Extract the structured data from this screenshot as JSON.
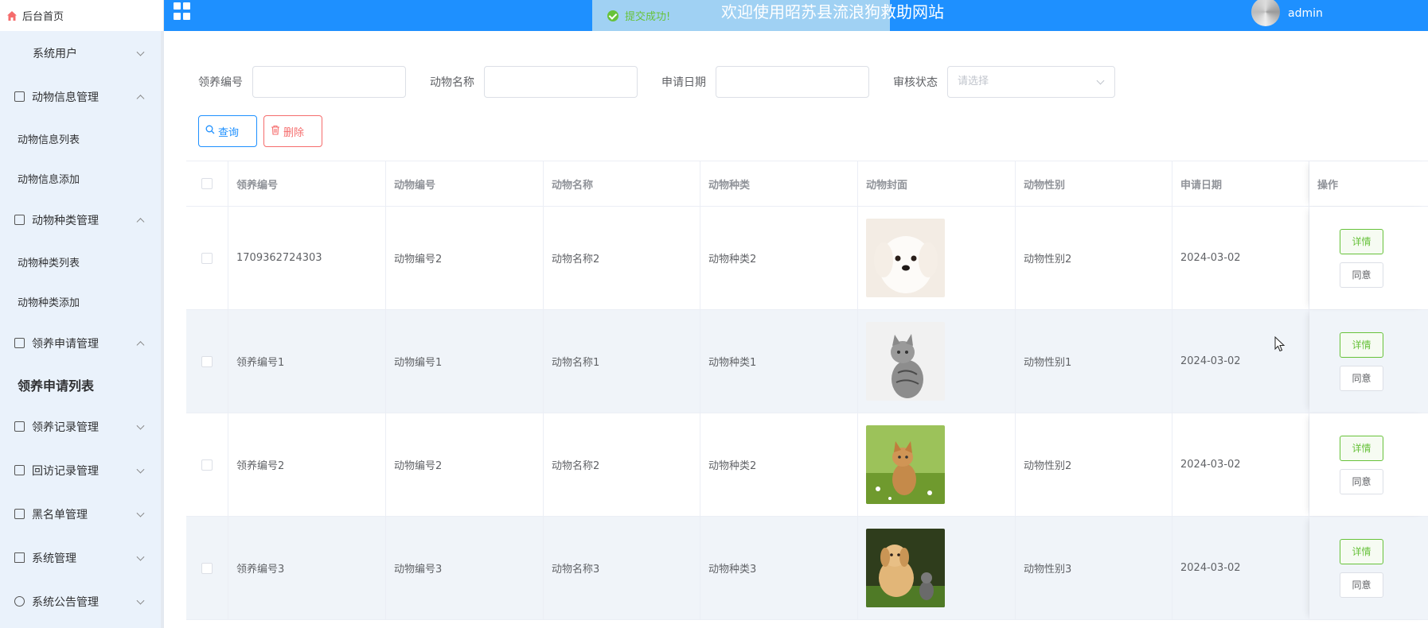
{
  "brand": {
    "label": "后台首页",
    "icon": "home-icon"
  },
  "header": {
    "title": "欢迎使用昭苏县流浪狗救助网站",
    "user": "admin",
    "toast": "提交成功!",
    "accent": "#1e90ff"
  },
  "sidebar": {
    "items": [
      {
        "label": "系统用户",
        "icon": "user-icon",
        "expanded": false
      },
      {
        "label": "动物信息管理",
        "icon": "module-icon",
        "expanded": true,
        "children": [
          "动物信息列表",
          "动物信息添加"
        ]
      },
      {
        "label": "动物种类管理",
        "icon": "module-icon",
        "expanded": true,
        "children": [
          "动物种类列表",
          "动物种类添加"
        ]
      },
      {
        "label": "领养申请管理",
        "icon": "module-icon",
        "expanded": true,
        "children": [
          "领养申请列表"
        ]
      },
      {
        "label": "领养记录管理",
        "icon": "module-icon",
        "expanded": false
      },
      {
        "label": "回访记录管理",
        "icon": "module-icon",
        "expanded": false
      },
      {
        "label": "黑名单管理",
        "icon": "module-icon",
        "expanded": false
      },
      {
        "label": "系统管理",
        "icon": "picture-icon",
        "expanded": false
      },
      {
        "label": "系统公告管理",
        "icon": "info-icon",
        "expanded": false
      }
    ],
    "active": "领养申请列表"
  },
  "filters": {
    "adopt_no": {
      "label": "领养编号",
      "value": ""
    },
    "animal_name": {
      "label": "动物名称",
      "value": ""
    },
    "apply_date": {
      "label": "申请日期",
      "value": ""
    },
    "audit_status": {
      "label": "审核状态",
      "placeholder": "请选择"
    }
  },
  "actions": {
    "query": "查询",
    "delete": "删除"
  },
  "table": {
    "columns": [
      "领养编号",
      "动物编号",
      "动物名称",
      "动物种类",
      "动物封面",
      "动物性别",
      "申请日期",
      "操作"
    ],
    "rows": [
      {
        "adopt_no": "1709362724303",
        "animal_no": "动物编号2",
        "animal_name": "动物名称2",
        "animal_type": "动物种类2",
        "cover": "white-dog",
        "gender": "动物性别2",
        "date": "2024-03-02",
        "detail": "详情",
        "agree": "同意"
      },
      {
        "adopt_no": "领养编号1",
        "animal_no": "动物编号1",
        "animal_name": "动物名称1",
        "animal_type": "动物种类1",
        "cover": "tabby-cat",
        "gender": "动物性别1",
        "date": "2024-03-02",
        "detail": "详情",
        "agree": "同意"
      },
      {
        "adopt_no": "领养编号2",
        "animal_no": "动物编号2",
        "animal_name": "动物名称2",
        "animal_type": "动物种类2",
        "cover": "orange-kitten",
        "gender": "动物性别2",
        "date": "2024-03-02",
        "detail": "详情",
        "agree": "同意"
      },
      {
        "adopt_no": "领养编号3",
        "animal_no": "动物编号3",
        "animal_name": "动物名称3",
        "animal_type": "动物种类3",
        "cover": "puppy-and-kitten",
        "gender": "动物性别3",
        "date": "2024-03-02",
        "detail": "详情",
        "agree": "同意"
      }
    ]
  }
}
